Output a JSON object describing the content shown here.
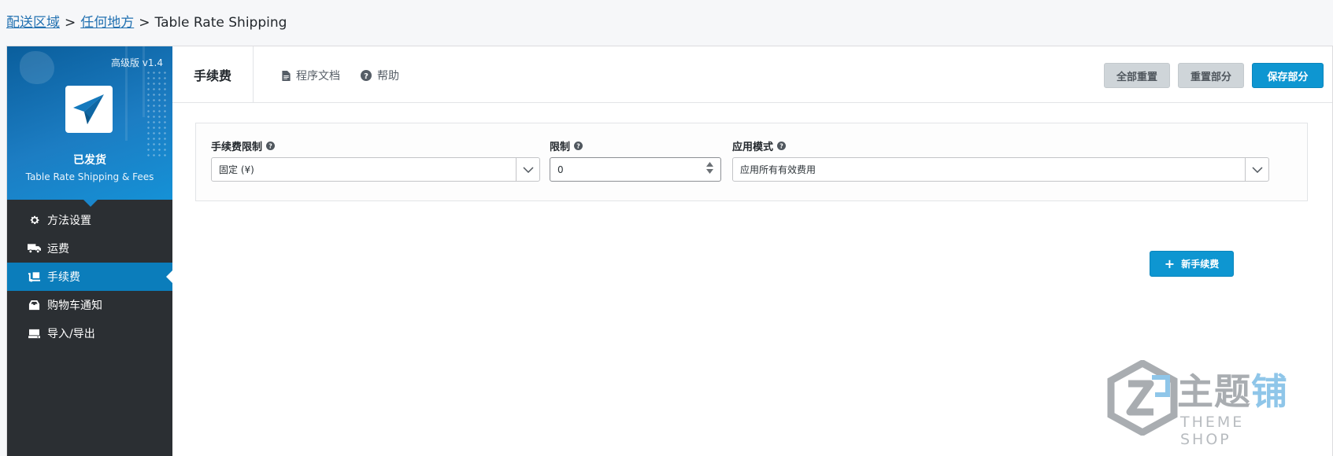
{
  "breadcrumb": {
    "items": [
      "配送区域",
      "任何地方"
    ],
    "separator": ">",
    "current": "Table Rate Shipping"
  },
  "sidebar": {
    "version": "高级版 v1.4",
    "brand": "已发货",
    "subtitle": "Table Rate Shipping & Fees",
    "items": [
      {
        "label": "方法设置",
        "icon": "gear-icon",
        "active": false
      },
      {
        "label": "运费",
        "icon": "truck-icon",
        "active": false
      },
      {
        "label": "手续费",
        "icon": "dolly-icon",
        "active": true
      },
      {
        "label": "购物车通知",
        "icon": "inbox-icon",
        "active": false
      },
      {
        "label": "导入/导出",
        "icon": "hdd-icon",
        "active": false
      }
    ]
  },
  "header": {
    "title": "手续费",
    "docs_link": "程序文档",
    "help_link": "帮助",
    "reset_all": "全部重置",
    "reset_section": "重置部分",
    "save_section": "保存部分"
  },
  "fees": {
    "limit_type_label": "手续费限制",
    "limit_type_value": "固定 (¥)",
    "limit_label": "限制",
    "limit_value": "0",
    "mode_label": "应用模式",
    "mode_value": "应用所有有效费用"
  },
  "add_fee": {
    "label": "新手续费"
  },
  "watermark": {
    "chinese": [
      "主",
      "题",
      "铺"
    ],
    "english": "THEME SHOP"
  },
  "colors": {
    "accent": "#0e96d1",
    "sidebar_bg": "#2b2f33",
    "sidebar_active": "#0b7dbb",
    "link": "#2271b1"
  }
}
